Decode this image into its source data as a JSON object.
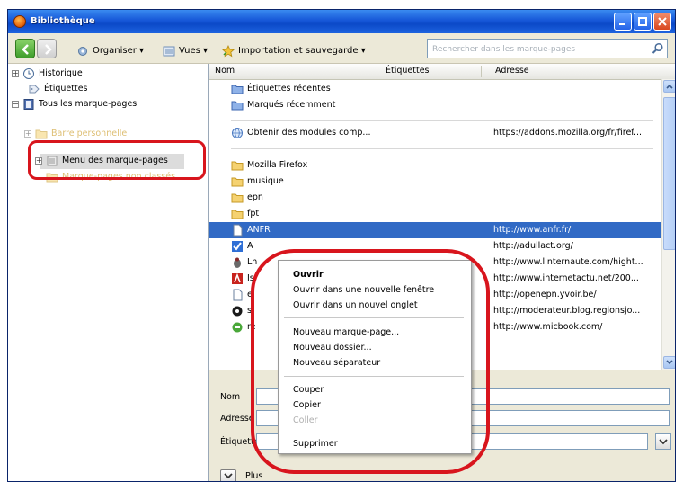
{
  "window": {
    "title": "Bibliothèque"
  },
  "toolbar": {
    "organize": "Organiser ▾",
    "views": "Vues ▾",
    "import": "Importation et sauvegarde ▾",
    "search_placeholder": "Rechercher dans les marque-pages"
  },
  "tree": {
    "history": "Historique",
    "tags": "Étiquettes",
    "all_bookmarks": "Tous les marque-pages",
    "toolbar_folder": "Barre personnelle",
    "bookmarks_menu": "Menu des marque-pages",
    "unsorted": "Marque-pages non classés"
  },
  "columns": {
    "name": "Nom",
    "tags": "Étiquettes",
    "address": "Adresse"
  },
  "rows": [
    {
      "name": "Étiquettes récentes",
      "address": "",
      "icon": "smart-folder-icon"
    },
    {
      "name": "Marqués récemment",
      "address": "",
      "icon": "smart-folder-icon"
    },
    {
      "name": "Obtenir des modules comp...",
      "address": "https://addons.mozilla.org/fr/firef...",
      "icon": "globe-icon"
    },
    {
      "name": "Mozilla Firefox",
      "address": "",
      "icon": "folder-icon"
    },
    {
      "name": "musique",
      "address": "",
      "icon": "folder-icon"
    },
    {
      "name": "epn",
      "address": "",
      "icon": "folder-icon"
    },
    {
      "name": "fpt",
      "address": "",
      "icon": "folder-icon"
    },
    {
      "name": "ANFR",
      "address": "http://www.anfr.fr/",
      "icon": "page-icon"
    },
    {
      "name": "A",
      "address": "http://adullact.org/",
      "icon": "check-icon"
    },
    {
      "name": "Ln",
      "address": "http://www.linternaute.com/hight...",
      "icon": "bug-icon"
    },
    {
      "name": "Is",
      "address": "http://www.internetactu.net/200...",
      "icon": "red-icon"
    },
    {
      "name": "e",
      "address": "http://openepn.yvoir.be/",
      "icon": "page-icon"
    },
    {
      "name": "s",
      "address": "http://moderateur.blog.regionsjo...",
      "icon": "dark-icon"
    },
    {
      "name": "re",
      "address": "http://www.micbook.com/",
      "icon": "green-icon"
    }
  ],
  "details": {
    "name_label": "Nom",
    "address_label": "Adresse",
    "tags_label": "Étiquettes",
    "more_label": "Plus"
  },
  "context_menu": {
    "open": "Ouvrir",
    "open_new_window": "Ouvrir dans une nouvelle fenêtre",
    "open_new_tab": "Ouvrir dans un nouvel onglet",
    "new_bookmark": "Nouveau marque-page...",
    "new_folder": "Nouveau dossier...",
    "new_separator": "Nouveau séparateur",
    "cut": "Couper",
    "copy": "Copier",
    "paste": "Coller",
    "delete": "Supprimer"
  }
}
